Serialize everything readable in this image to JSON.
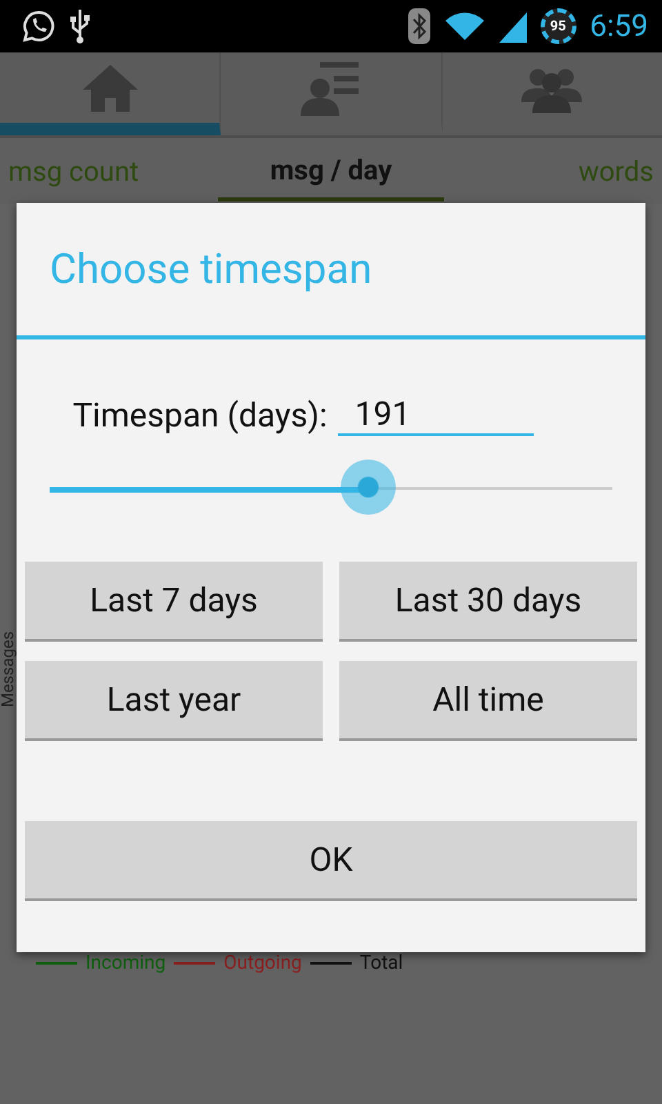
{
  "status_bar": {
    "battery": "95",
    "time": "6:59"
  },
  "action_tabs": [
    {
      "kind": "home",
      "selected": true
    },
    {
      "kind": "list",
      "selected": false
    },
    {
      "kind": "group",
      "selected": false
    }
  ],
  "sub_tabs": [
    {
      "label": "msg count",
      "selected": false
    },
    {
      "label": "msg / day",
      "selected": true
    },
    {
      "label": "words",
      "selected": false
    }
  ],
  "chart": {
    "ylabel": "Messages",
    "legend": [
      {
        "label": "Incoming",
        "color": "#0f5f0f"
      },
      {
        "label": "Outgoing",
        "color": "#8a1f1f"
      },
      {
        "label": "Total",
        "color": "#111111"
      }
    ]
  },
  "dialog": {
    "title": "Choose timespan",
    "field_label": "Timespan (days):",
    "field_value": "191",
    "slider": {
      "level": 0.566
    },
    "presets": [
      "Last 7 days",
      "Last 30 days",
      "Last year",
      "All time"
    ],
    "ok": "OK"
  }
}
